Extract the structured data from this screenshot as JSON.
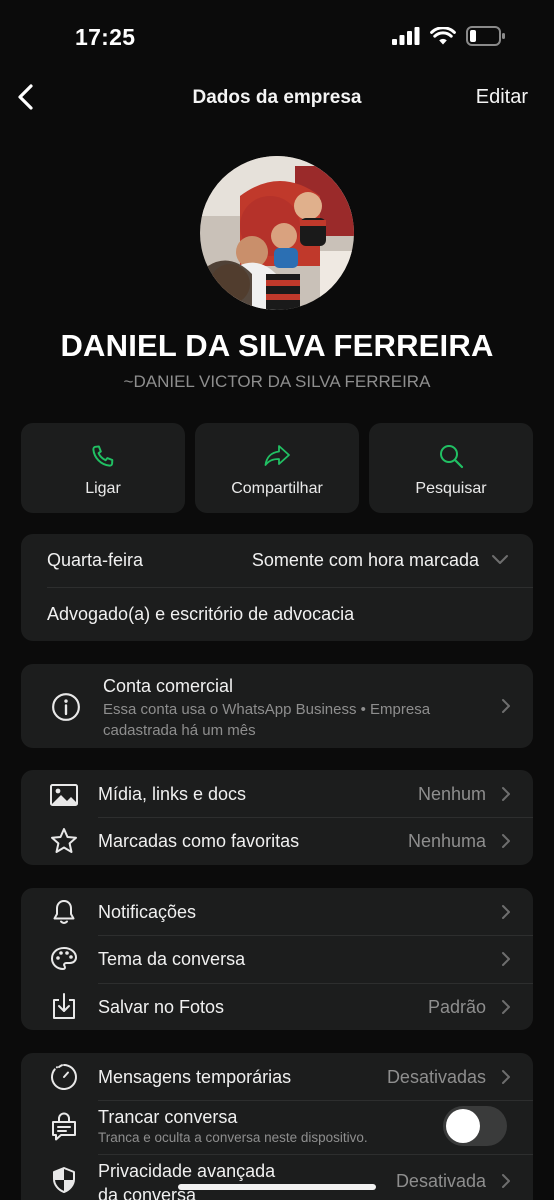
{
  "status": {
    "time": "17:25"
  },
  "nav": {
    "title": "Dados da empresa",
    "edit_label": "Editar"
  },
  "profile": {
    "name": "DANIEL DA SILVA FERREIRA",
    "subtitle": "~DANIEL VICTOR DA SILVA FERREIRA"
  },
  "actions": [
    {
      "label": "Ligar",
      "icon": "phone-icon"
    },
    {
      "label": "Compartilhar",
      "icon": "share-icon"
    },
    {
      "label": "Pesquisar",
      "icon": "search-icon"
    }
  ],
  "business_info": {
    "day": "Quarta-feira",
    "hours": "Somente com hora marcada",
    "category": "Advogado(a) e escritório de advocacia"
  },
  "business_account": {
    "title": "Conta comercial",
    "description": "Essa conta usa o WhatsApp Business • Empresa cadastrada há um mês"
  },
  "media": [
    {
      "label": "Mídia, links e docs",
      "value": "Nenhum",
      "icon": "image-icon"
    },
    {
      "label": "Marcadas como favoritas",
      "value": "Nenhuma",
      "icon": "star-icon"
    }
  ],
  "settings": [
    {
      "label": "Notificações",
      "value": "",
      "icon": "bell-icon"
    },
    {
      "label": "Tema da conversa",
      "value": "",
      "icon": "palette-icon"
    },
    {
      "label": "Salvar no Fotos",
      "value": "Padrão",
      "icon": "download-icon"
    }
  ],
  "privacy": {
    "disappearing": {
      "label": "Mensagens temporárias",
      "value": "Desativadas"
    },
    "lock": {
      "label": "Trancar conversa",
      "subtitle": "Tranca e oculta a conversa neste dispositivo.",
      "enabled": false
    },
    "advanced": {
      "label_line1": "Privacidade avançada",
      "label_line2": "da conversa",
      "value": "Desativada"
    }
  },
  "colors": {
    "accent": "#21c063",
    "card_bg": "#1c1d1d",
    "background": "#0b0b0b",
    "secondary_text": "#8e8e8e"
  }
}
